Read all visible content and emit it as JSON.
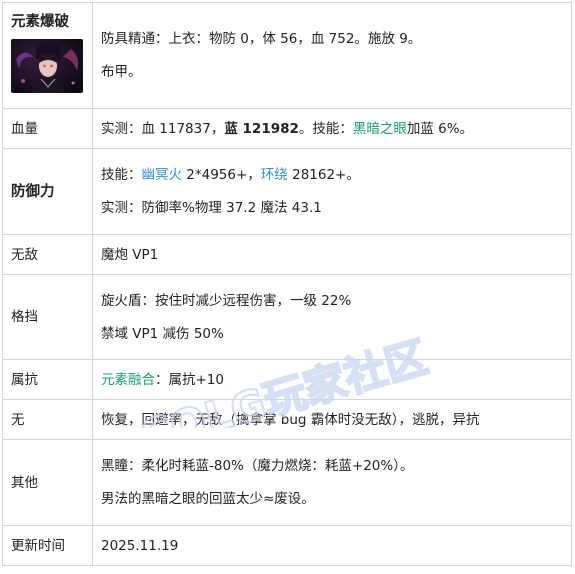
{
  "rows": {
    "r1": {
      "label": "元素爆破",
      "lines": [
        "防具精通：上衣：物防 0，体 56，血 752。施放 9。",
        "布甲。"
      ]
    },
    "r2": {
      "label": "血量",
      "t1": "实测：血 117837，",
      "t2": "蓝 121982",
      "t3": "。技能：",
      "t4": "黑暗之眼",
      "t5": "加蓝 6%。"
    },
    "r3": {
      "label": "防御力",
      "a1": "技能：",
      "a2": "幽冥火",
      "a3": " 2*4956+，",
      "a4": "环绕",
      "a5": " 28162+。",
      "line2": "实测：防御率%物理 37.2 魔法 43.1"
    },
    "r4": {
      "label": "无敌",
      "text": "魔炮 VP1"
    },
    "r5": {
      "label": "格挡",
      "lines": [
        "旋火盾：按住时减少远程伤害，一级 22%",
        "禁域 VP1 减伤 50%"
      ]
    },
    "r6": {
      "label": "属抗",
      "g": "元素融合",
      "rest": "：属抗+10"
    },
    "r7": {
      "label": "无",
      "text": "恢复，回避率，无敌（擒拿掌 bug 霸体时没无敌），逃脱，异抗"
    },
    "r8": {
      "label": "其他",
      "lines": [
        "黑瞳：柔化时耗蓝-80%（魔力燃烧：耗蓝+20%）。",
        "男法的黑暗之眼的回蓝太少≈废设。"
      ]
    },
    "r9": {
      "label": "更新时间",
      "text": "2025.11.19"
    }
  },
  "watermark": "COLG玩家社区",
  "colors": {
    "green": "#1e9b6e",
    "blue": "#2f8fd8",
    "watermark": "#c9d6f2"
  }
}
